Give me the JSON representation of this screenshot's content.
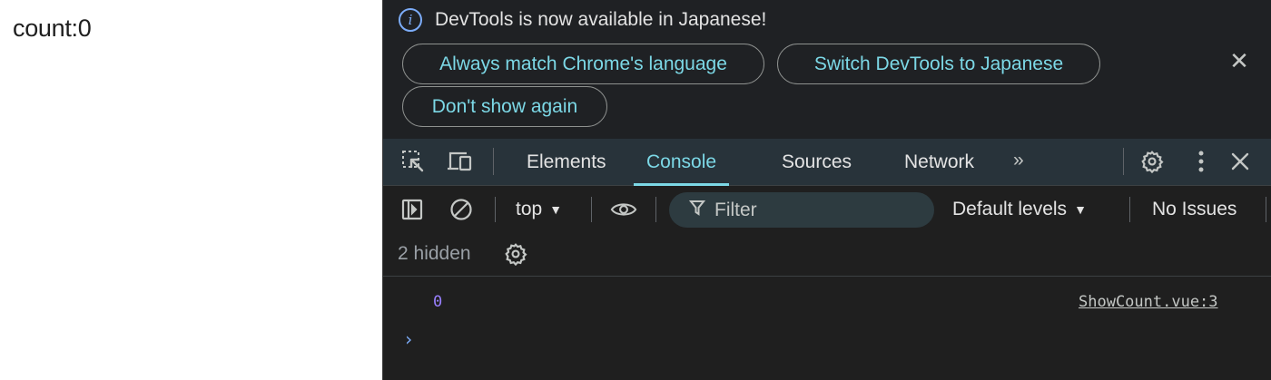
{
  "page": {
    "text": "count:0"
  },
  "infobar": {
    "message": "DevTools is now available in Japanese!",
    "info_glyph": "i",
    "buttons": {
      "match_language": "Always match Chrome's language",
      "switch_japanese": "Switch DevTools to Japanese",
      "dont_show": "Don't show again"
    },
    "close_glyph": "✕"
  },
  "tabs": {
    "items": [
      "Elements",
      "Console",
      "Sources",
      "Network"
    ],
    "active": "Console",
    "more_glyph": "»"
  },
  "console_toolbar": {
    "context": "top",
    "filter_placeholder": "Filter",
    "levels": "Default levels",
    "issues": "No Issues"
  },
  "status": {
    "hidden": "2 hidden"
  },
  "messages": [
    {
      "value": "0",
      "source": "ShowCount.vue:3"
    }
  ],
  "prompt_glyph": "›",
  "colors": {
    "accent": "#7cd8e6",
    "number": "#9980ff",
    "info": "#7cacf8",
    "panel_bg": "#1f1f1f",
    "tabbar_bg": "#28333a"
  },
  "icons": [
    "info-icon",
    "close-icon",
    "inspect-element-icon",
    "device-toolbar-icon",
    "more-tabs-icon",
    "settings-gear-icon",
    "kebab-menu-icon",
    "sidebar-toggle-icon",
    "clear-console-icon",
    "eye-icon",
    "filter-icon",
    "dropdown-caret-icon"
  ]
}
